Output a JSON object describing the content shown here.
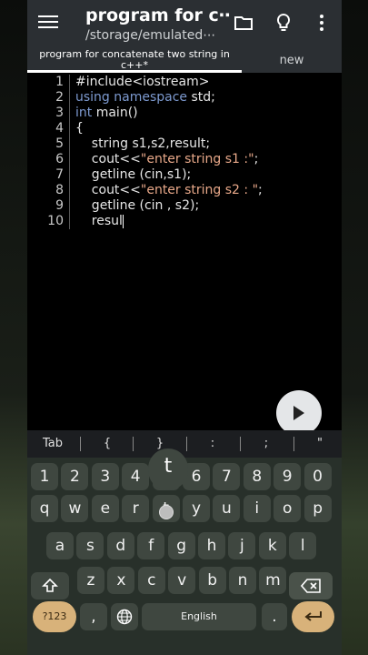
{
  "appbar": {
    "title": "program for c⋯",
    "subtitle": "/storage/emulated⋯"
  },
  "tabs": [
    {
      "label": "program for concatenate two string in c++*",
      "active": true
    },
    {
      "label": "new",
      "active": false
    }
  ],
  "editor": {
    "line_numbers": [
      "1",
      "2",
      "3",
      "4",
      "5",
      "6",
      "7",
      "8",
      "9",
      "10"
    ],
    "lines": [
      [
        {
          "t": "#include<iostream>",
          "c": "plain"
        }
      ],
      [
        {
          "t": "using namespace",
          "c": "kw"
        },
        {
          "t": " std;",
          "c": "plain"
        }
      ],
      [
        {
          "t": "int",
          "c": "kw"
        },
        {
          "t": " main()",
          "c": "plain"
        }
      ],
      [
        {
          "t": "{",
          "c": "plain"
        }
      ],
      [
        {
          "t": "    string s1,s2,result;",
          "c": "plain"
        }
      ],
      [
        {
          "t": "    cout<<",
          "c": "plain"
        },
        {
          "t": "\"enter string s1 :\"",
          "c": "str"
        },
        {
          "t": ";",
          "c": "plain"
        }
      ],
      [
        {
          "t": "    getline (cin,s1);",
          "c": "plain"
        }
      ],
      [
        {
          "t": "    cout<<",
          "c": "plain"
        },
        {
          "t": "\"enter string s2 : \"",
          "c": "str"
        },
        {
          "t": ";",
          "c": "plain"
        }
      ],
      [
        {
          "t": "    getline (cin , s2);",
          "c": "plain"
        }
      ],
      [
        {
          "t": "    resul",
          "c": "plain"
        }
      ]
    ]
  },
  "symbols": [
    "Tab",
    "{",
    "}",
    ":",
    ";",
    "\""
  ],
  "keyboard": {
    "popup_letter": "t",
    "numbers": [
      "1",
      "2",
      "3",
      "4",
      "5",
      "6",
      "7",
      "8",
      "9",
      "0"
    ],
    "row1": [
      "q",
      "w",
      "e",
      "r",
      "t",
      "y",
      "u",
      "i",
      "o",
      "p"
    ],
    "row2": [
      "a",
      "s",
      "d",
      "f",
      "g",
      "h",
      "j",
      "k",
      "l"
    ],
    "row3": [
      "z",
      "x",
      "c",
      "v",
      "b",
      "n",
      "m"
    ],
    "sym_key": "?123",
    "comma": ",",
    "space_label": "English",
    "period": "."
  },
  "colors": {
    "keyword": "#7d9ad0",
    "string": "#e8a889",
    "accent": "#d8b27a"
  }
}
